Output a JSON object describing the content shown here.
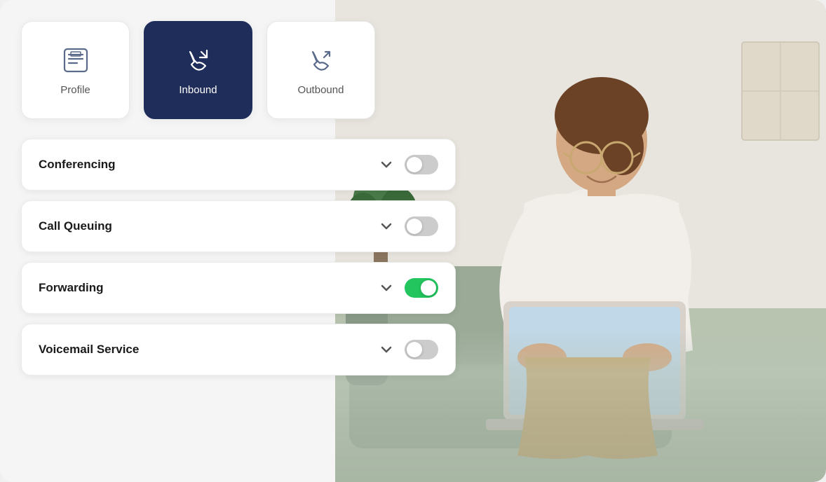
{
  "tabs": [
    {
      "id": "profile",
      "label": "Profile",
      "active": false,
      "icon": "profile-icon"
    },
    {
      "id": "inbound",
      "label": "Inbound",
      "active": true,
      "icon": "inbound-icon"
    },
    {
      "id": "outbound",
      "label": "Outbound",
      "active": false,
      "icon": "outbound-icon"
    }
  ],
  "settings": [
    {
      "id": "conferencing",
      "label": "Conferencing",
      "enabled": false
    },
    {
      "id": "call-queuing",
      "label": "Call Queuing",
      "enabled": false
    },
    {
      "id": "forwarding",
      "label": "Forwarding",
      "enabled": true
    },
    {
      "id": "voicemail-service",
      "label": "Voicemail Service",
      "enabled": false
    }
  ],
  "colors": {
    "active_tab_bg": "#1e2d5a",
    "toggle_on": "#22c55e",
    "toggle_off": "#cccccc"
  }
}
